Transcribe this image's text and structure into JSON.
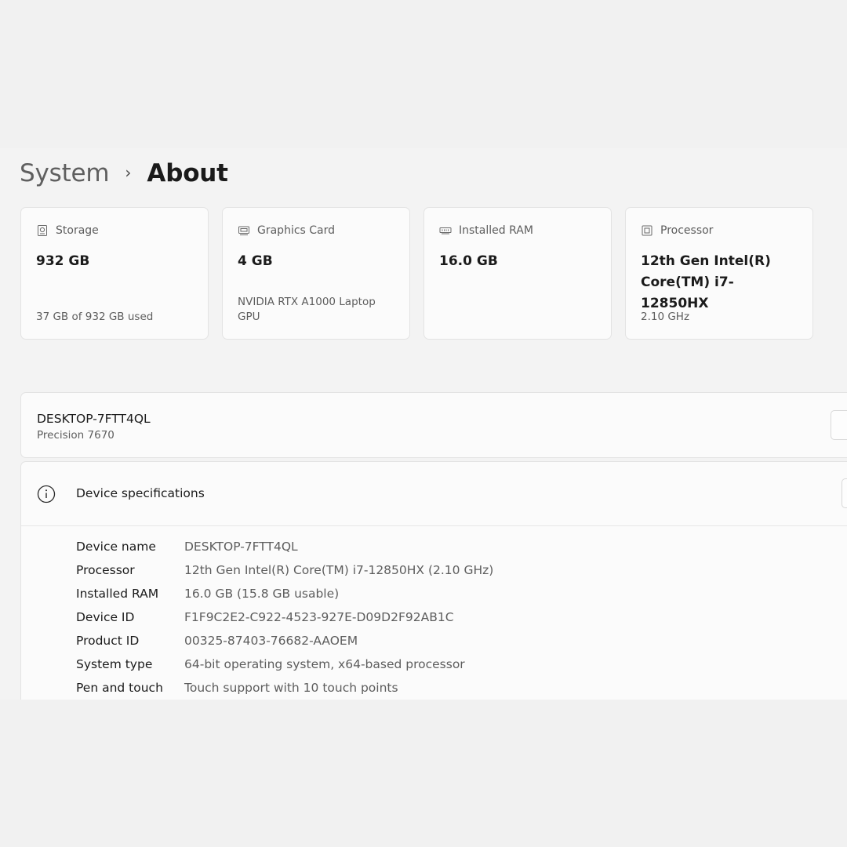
{
  "breadcrumb": {
    "parent": "System",
    "separator": "›",
    "current": "About"
  },
  "cards": [
    {
      "icon": "storage-icon",
      "title": "Storage",
      "value": "932 GB",
      "sub": "37 GB of 932 GB used"
    },
    {
      "icon": "graphics-card-icon",
      "title": "Graphics Card",
      "value": "4 GB",
      "sub": "NVIDIA RTX A1000 Laptop GPU"
    },
    {
      "icon": "ram-icon",
      "title": "Installed RAM",
      "value": "16.0 GB",
      "sub": ""
    },
    {
      "icon": "processor-icon",
      "title": "Processor",
      "value": "12th Gen Intel(R) Core(TM) i7-12850HX",
      "sub": "2.10 GHz"
    }
  ],
  "device": {
    "name": "DESKTOP-7FTT4QL",
    "model": "Precision 7670"
  },
  "specs": {
    "title": "Device specifications",
    "rows": [
      {
        "label": "Device name",
        "value": "DESKTOP-7FTT4QL"
      },
      {
        "label": "Processor",
        "value": "12th Gen Intel(R) Core(TM) i7-12850HX (2.10 GHz)"
      },
      {
        "label": "Installed RAM",
        "value": "16.0 GB (15.8 GB usable)"
      },
      {
        "label": "Device ID",
        "value": "F1F9C2E2-C922-4523-927E-D09D2F92AB1C"
      },
      {
        "label": "Product ID",
        "value": "00325-87403-76682-AAOEM"
      },
      {
        "label": "System type",
        "value": "64-bit operating system, x64-based processor"
      },
      {
        "label": "Pen and touch",
        "value": "Touch support with 10 touch points"
      }
    ]
  },
  "colors": {
    "page_background": "#f3f3f3",
    "card_background": "#fbfbfb",
    "secondary_text": "#5d5d5d"
  }
}
